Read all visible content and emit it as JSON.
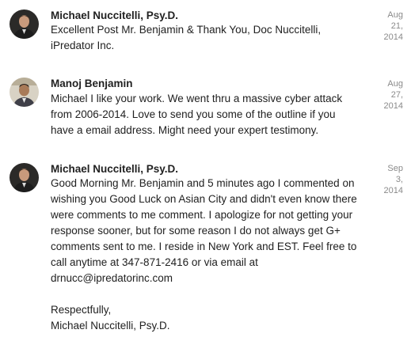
{
  "comments": [
    {
      "author": "Michael Nuccitelli, Psy.D.",
      "avatar_icon": "user-avatar-michael",
      "text": "Excellent Post Mr. Benjamin & Thank You, Doc Nuccitelli,\niPredator Inc.",
      "date": {
        "month": "Aug",
        "day": "21,",
        "year": "2014"
      }
    },
    {
      "author": "Manoj Benjamin",
      "avatar_icon": "user-avatar-manoj",
      "text": "Michael I like your work. We went thru a massive cyber attack\nfrom 2006-2014. Love to send you some of the outline if you\nhave a email address. Might need your expert testimony.",
      "date": {
        "month": "Aug",
        "day": "27,",
        "year": "2014"
      }
    },
    {
      "author": "Michael Nuccitelli, Psy.D.",
      "avatar_icon": "user-avatar-michael",
      "text": "Good Morning Mr. Benjamin and 5 minutes ago I commented on\nwishing you Good Luck on Asian City and didn't even know there\nwere comments to me comment. I apologize for not getting your\nresponse sooner, but for some reason I do not always get G+\ncomments sent to me. I reside in New York and EST. Feel free to\ncall anytime at 347-871-2416 or via email at\ndrnucc@ipredatorinc.com\n\nRespectfully,\nMichael Nuccitelli, Psy.D.",
      "date": {
        "month": "Sep",
        "day": "3,",
        "year": "2014"
      }
    }
  ]
}
